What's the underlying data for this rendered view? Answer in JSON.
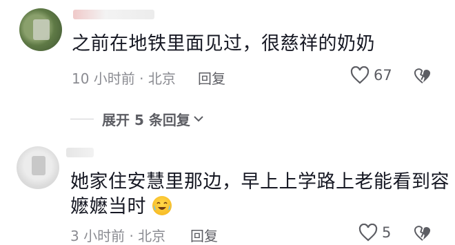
{
  "comments": [
    {
      "text": "之前在地铁里面见过，很慈祥的奶奶",
      "meta": "10 小时前 · 北京",
      "reply_label": "回复",
      "like_count": "67",
      "expand_label": "展开 5 条回复"
    },
    {
      "text_line1": "她家住安慧里那边，早上上学路上老能看到容",
      "text_line2": "嬷嬷当时",
      "emoji": "laughing-crying-emoji",
      "meta": "3 小时前 · 北京",
      "reply_label": "回复",
      "like_count": "5"
    }
  ],
  "colors": {
    "text": "#161823",
    "meta": "#8a8b91",
    "action": "#5c5d63"
  }
}
